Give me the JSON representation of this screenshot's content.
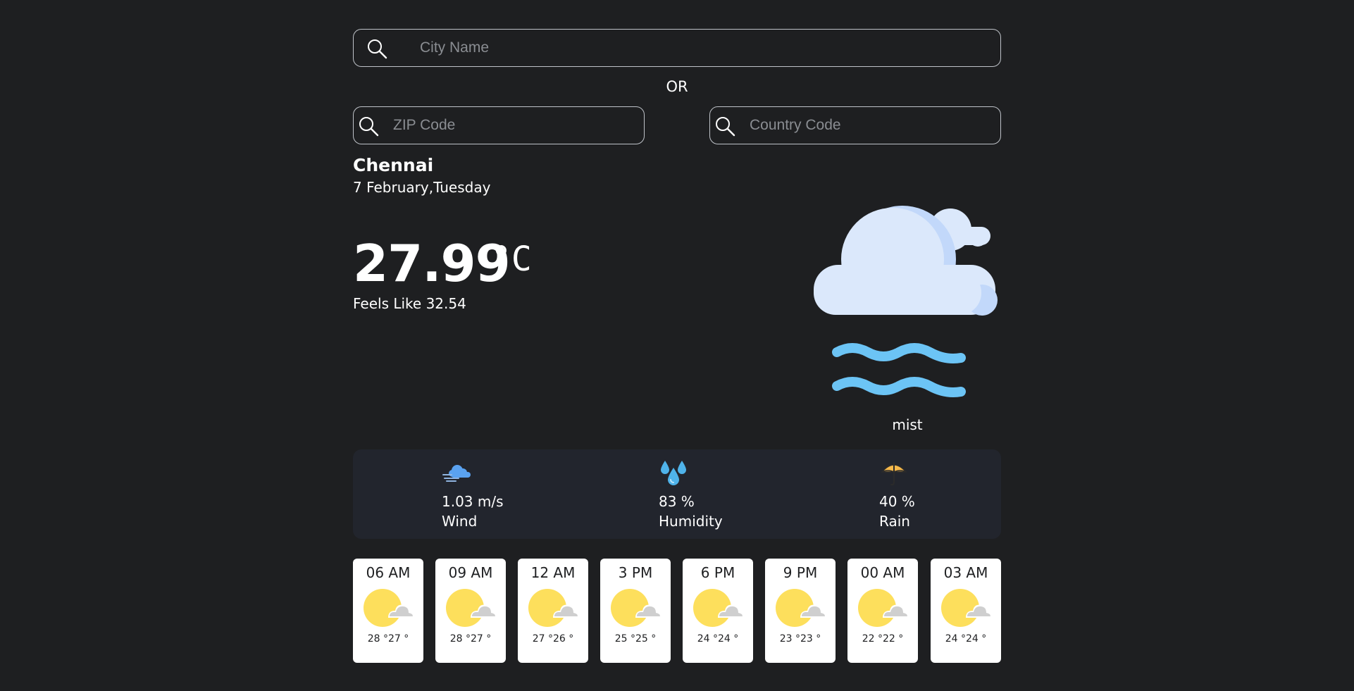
{
  "search": {
    "city_placeholder": "City Name",
    "or_label": "OR",
    "zip_placeholder": "ZIP Code",
    "country_placeholder": "Country Code"
  },
  "current": {
    "city": "Chennai",
    "date": "7 February,Tuesday",
    "temperature": "27.99",
    "unit": "°C",
    "feels_like": "Feels Like 32.54",
    "description": "mist",
    "icon": "mist-cloud-icon"
  },
  "stats": {
    "wind": {
      "value": "1.03 m/s",
      "label": "Wind",
      "icon": "wind-cloud-icon"
    },
    "humidity": {
      "value": "83 %",
      "label": "Humidity",
      "icon": "water-drops-icon"
    },
    "rain": {
      "value": "40 %",
      "label": "Rain",
      "icon": "umbrella-icon"
    }
  },
  "forecast": [
    {
      "time": "06 AM",
      "temps": "28 °27 °",
      "icon": "partly-cloudy-icon"
    },
    {
      "time": "09 AM",
      "temps": "28 °27 °",
      "icon": "partly-cloudy-icon"
    },
    {
      "time": "12 AM",
      "temps": "27 °26 °",
      "icon": "partly-cloudy-icon"
    },
    {
      "time": "3 PM",
      "temps": "25 °25 °",
      "icon": "partly-cloudy-icon"
    },
    {
      "time": "6 PM",
      "temps": "24 °24 °",
      "icon": "partly-cloudy-icon"
    },
    {
      "time": "9 PM",
      "temps": "23 °23 °",
      "icon": "partly-cloudy-icon"
    },
    {
      "time": "00 AM",
      "temps": "22 °22 °",
      "icon": "partly-cloudy-icon"
    },
    {
      "time": "03 AM",
      "temps": "24 °24 °",
      "icon": "partly-cloudy-icon"
    }
  ],
  "colors": {
    "background": "#1e1f21",
    "stats_panel": "#22252d",
    "card": "#ffffff",
    "sun": "#fddf5c",
    "cloud": "#dbe8fb",
    "mist": "#6cc4f5"
  }
}
